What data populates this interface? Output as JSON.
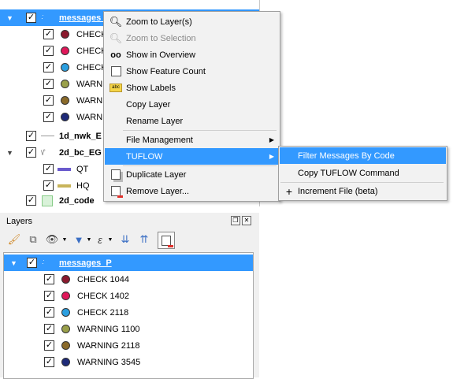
{
  "top_tree": {
    "group_name": "messages_P",
    "items": [
      {
        "label": "CHECK",
        "color": "#8b1a2e"
      },
      {
        "label": "CHECK",
        "color": "#e0185a"
      },
      {
        "label": "CHECK",
        "color": "#2b9fe0"
      },
      {
        "label": "WARNI",
        "color": "#9aa04a"
      },
      {
        "label": "WARNI",
        "color": "#8a6a2a"
      },
      {
        "label": "WARNI",
        "color": "#1e2a78"
      }
    ],
    "nwk_label": "1d_nwk_E",
    "bc_label": "2d_bc_EG",
    "bc_items": [
      {
        "label": "QT",
        "color": "#6a5acd"
      },
      {
        "label": "HQ",
        "color": "#c8b45a"
      }
    ],
    "code_label": "2d_code"
  },
  "context_menu": {
    "zoom_to_layer": "Zoom to Layer(s)",
    "zoom_to_selection": "Zoom to Selection",
    "show_in_overview": "Show in Overview",
    "show_feature_count": "Show Feature Count",
    "show_labels": "Show Labels",
    "copy_layer": "Copy Layer",
    "rename_layer": "Rename Layer",
    "file_management": "File Management",
    "tuflow": "TUFLOW",
    "duplicate_layer": "Duplicate Layer",
    "remove_layer": "Remove Layer..."
  },
  "submenu": {
    "filter_messages": "Filter Messages By Code",
    "copy_tuflow_command": "Copy TUFLOW Command",
    "increment_file": "Increment File (beta)"
  },
  "layers_panel": {
    "title": "Layers",
    "group_name": "messages_P",
    "items": [
      {
        "label": "CHECK 1044",
        "color": "#8b1a2e"
      },
      {
        "label": "CHECK 1402",
        "color": "#e0185a"
      },
      {
        "label": "CHECK 2118",
        "color": "#2b9fe0"
      },
      {
        "label": "WARNING 1100",
        "color": "#9aa04a"
      },
      {
        "label": "WARNING 2118",
        "color": "#8a6a2a"
      },
      {
        "label": "WARNING 3545",
        "color": "#1e2a78"
      }
    ]
  }
}
